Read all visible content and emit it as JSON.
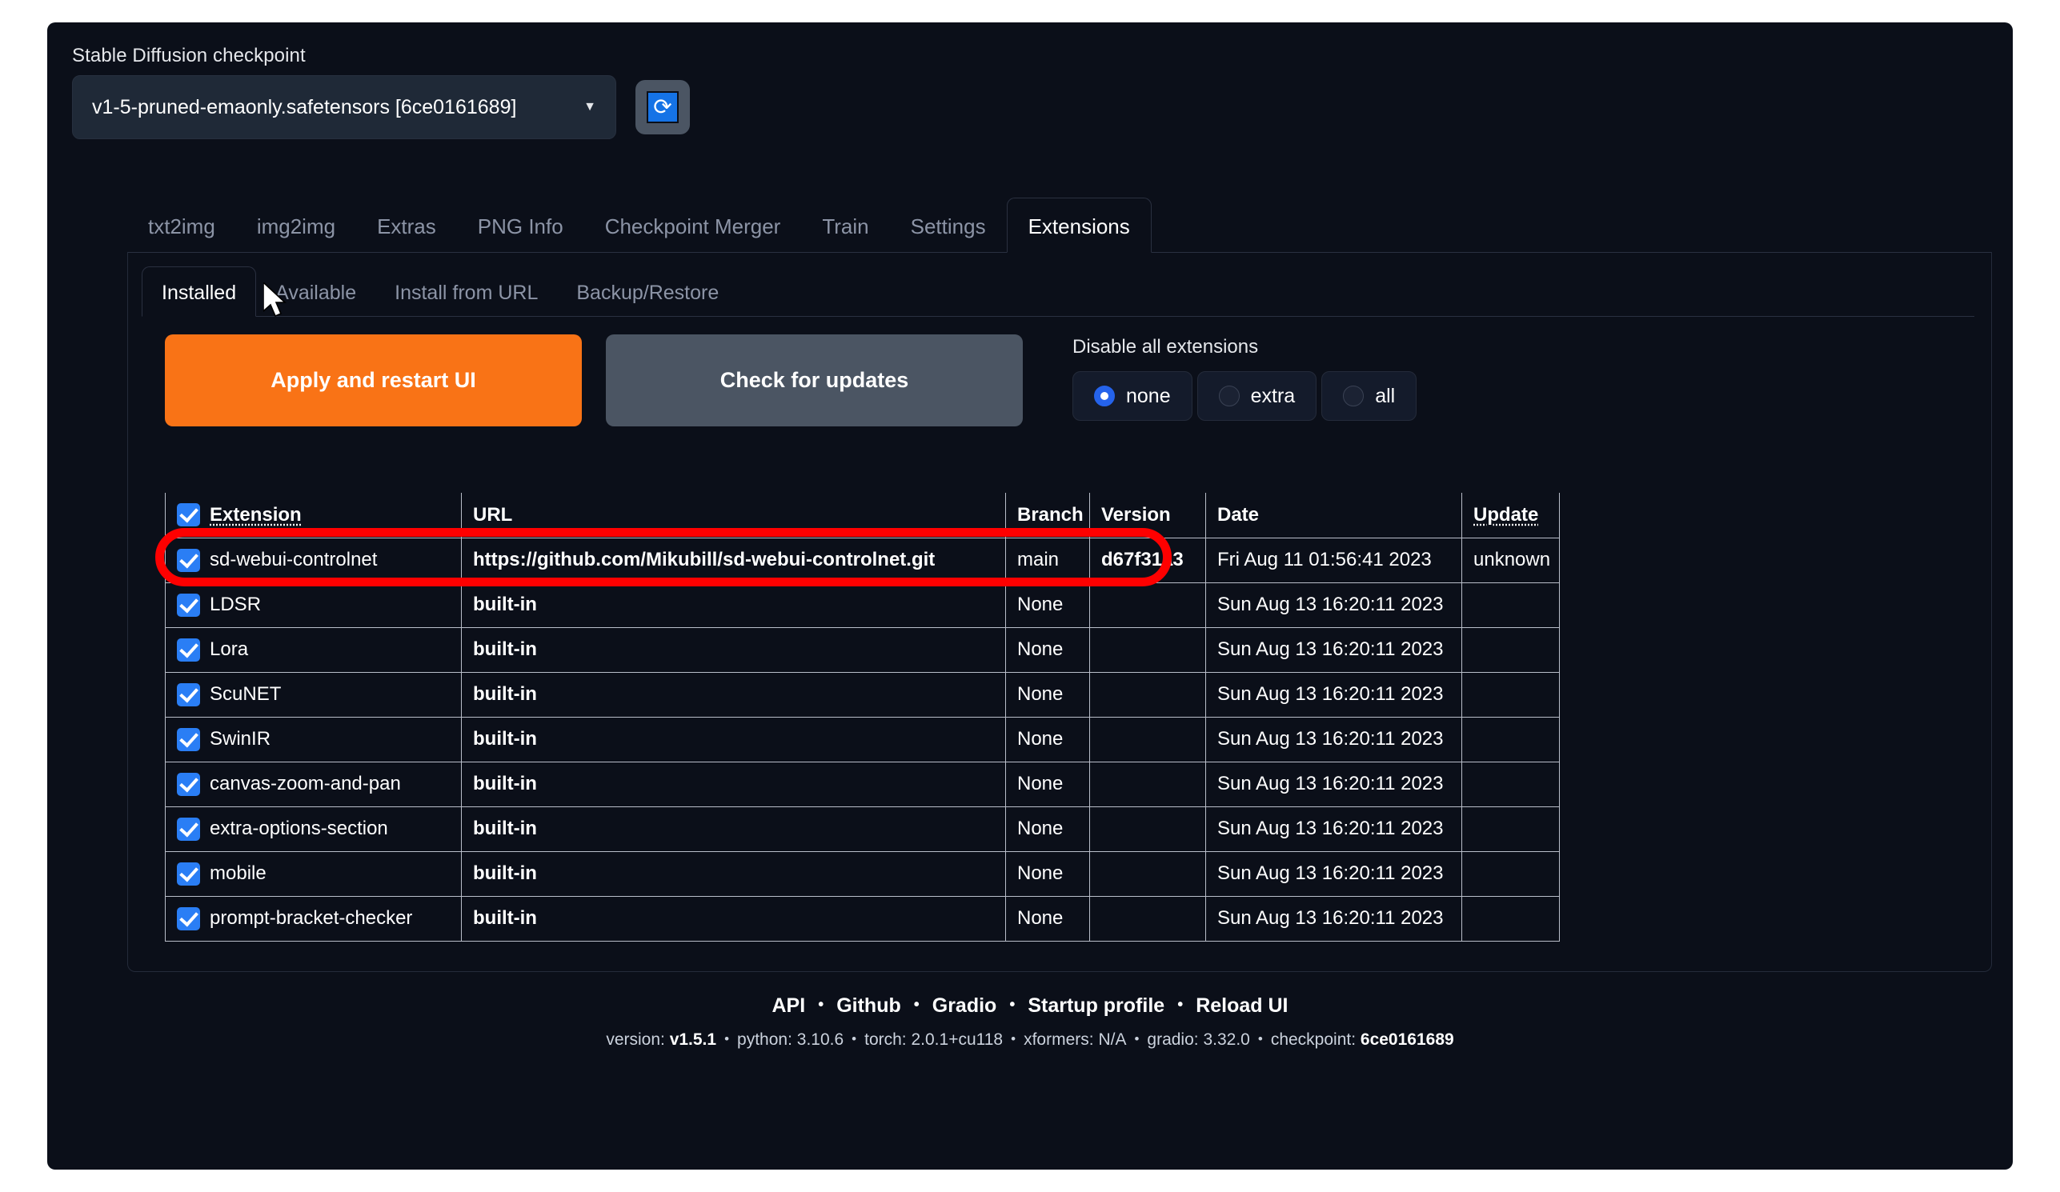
{
  "checkpoint": {
    "label": "Stable Diffusion checkpoint",
    "value": "v1-5-pruned-emaonly.safetensors [6ce0161689]",
    "caret": "▼",
    "refresh_icon": "refresh-icon",
    "refresh_glyph": "⟳"
  },
  "main_tabs": [
    {
      "label": "txt2img",
      "active": false
    },
    {
      "label": "img2img",
      "active": false
    },
    {
      "label": "Extras",
      "active": false
    },
    {
      "label": "PNG Info",
      "active": false
    },
    {
      "label": "Checkpoint Merger",
      "active": false
    },
    {
      "label": "Train",
      "active": false
    },
    {
      "label": "Settings",
      "active": false
    },
    {
      "label": "Extensions",
      "active": true
    }
  ],
  "sub_tabs": [
    {
      "label": "Installed",
      "active": true
    },
    {
      "label": "Available",
      "active": false
    },
    {
      "label": "Install from URL",
      "active": false
    },
    {
      "label": "Backup/Restore",
      "active": false
    }
  ],
  "actions": {
    "apply_label": "Apply and restart UI",
    "check_label": "Check for updates"
  },
  "disable_all": {
    "title": "Disable all extensions",
    "options": [
      {
        "label": "none",
        "selected": true
      },
      {
        "label": "extra",
        "selected": false
      },
      {
        "label": "all",
        "selected": false
      }
    ]
  },
  "table": {
    "headers": {
      "extension": "Extension",
      "url": "URL",
      "branch": "Branch",
      "version": "Version",
      "date": "Date",
      "update": "Update"
    },
    "header_checkbox_checked": true,
    "rows": [
      {
        "checked": true,
        "extension": "sd-webui-controlnet",
        "url": "https://github.com/Mikubill/sd-webui-controlnet.git",
        "url_bold": true,
        "branch": "main",
        "version": "d67f31a3",
        "date": "Fri Aug 11 01:56:41 2023",
        "update": "unknown",
        "highlighted": true
      },
      {
        "checked": true,
        "extension": "LDSR",
        "url": "built-in",
        "url_bold": true,
        "branch": "None",
        "version": "",
        "date": "Sun Aug 13 16:20:11 2023",
        "update": ""
      },
      {
        "checked": true,
        "extension": "Lora",
        "url": "built-in",
        "url_bold": true,
        "branch": "None",
        "version": "",
        "date": "Sun Aug 13 16:20:11 2023",
        "update": ""
      },
      {
        "checked": true,
        "extension": "ScuNET",
        "url": "built-in",
        "url_bold": true,
        "branch": "None",
        "version": "",
        "date": "Sun Aug 13 16:20:11 2023",
        "update": ""
      },
      {
        "checked": true,
        "extension": "SwinIR",
        "url": "built-in",
        "url_bold": true,
        "branch": "None",
        "version": "",
        "date": "Sun Aug 13 16:20:11 2023",
        "update": ""
      },
      {
        "checked": true,
        "extension": "canvas-zoom-and-pan",
        "url": "built-in",
        "url_bold": true,
        "branch": "None",
        "version": "",
        "date": "Sun Aug 13 16:20:11 2023",
        "update": ""
      },
      {
        "checked": true,
        "extension": "extra-options-section",
        "url": "built-in",
        "url_bold": true,
        "branch": "None",
        "version": "",
        "date": "Sun Aug 13 16:20:11 2023",
        "update": ""
      },
      {
        "checked": true,
        "extension": "mobile",
        "url": "built-in",
        "url_bold": true,
        "branch": "None",
        "version": "",
        "date": "Sun Aug 13 16:20:11 2023",
        "update": ""
      },
      {
        "checked": true,
        "extension": "prompt-bracket-checker",
        "url": "built-in",
        "url_bold": true,
        "branch": "None",
        "version": "",
        "date": "Sun Aug 13 16:20:11 2023",
        "update": ""
      }
    ]
  },
  "annotation": {
    "shape": "red-rounded-rectangle",
    "color": "#fe0000",
    "targets": "sd-webui-controlnet row"
  },
  "footer": {
    "links": [
      "API",
      "Github",
      "Gradio",
      "Startup profile",
      "Reload UI"
    ],
    "separator": "•",
    "info": [
      {
        "key": "version:",
        "value": "v1.5.1"
      },
      {
        "key": "python:",
        "value": "3.10.6"
      },
      {
        "key": "torch:",
        "value": "2.0.1+cu118"
      },
      {
        "key": "xformers:",
        "value": "N/A"
      },
      {
        "key": "gradio:",
        "value": "3.32.0"
      },
      {
        "key": "checkpoint:",
        "value": "6ce0161689"
      }
    ]
  },
  "colors": {
    "panel_bg": "#0b0f19",
    "accent_orange": "#f97316",
    "accent_blue": "#2a7ef5",
    "annotation_red": "#fe0000"
  }
}
